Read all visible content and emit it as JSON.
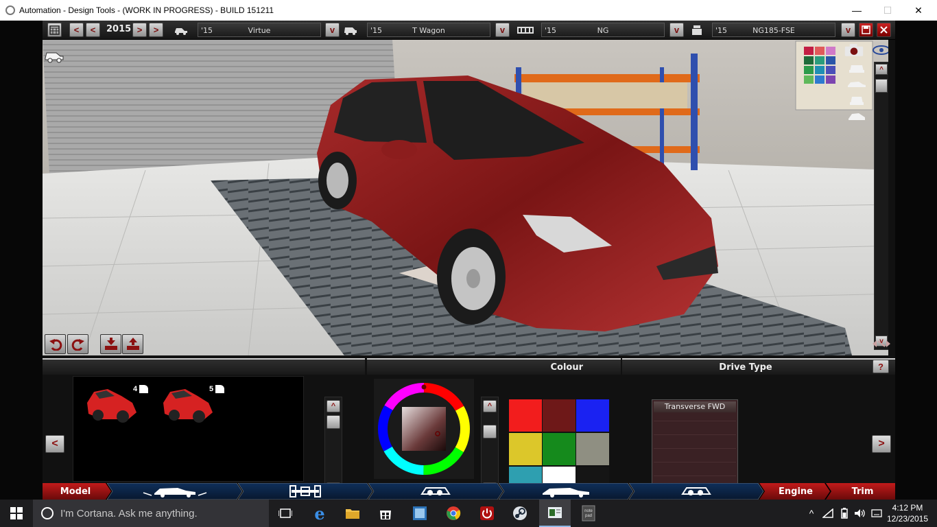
{
  "window": {
    "title": "Automation - Design Tools - (WORK IN PROGRESS) - BUILD 151211",
    "minimize": "—",
    "maximize": "☐",
    "close": "✕"
  },
  "toolbar": {
    "year": "2015",
    "selectors": [
      {
        "year": "'15",
        "name": "Virtue"
      },
      {
        "year": "'15",
        "name": "T  Wagon"
      },
      {
        "year": "'15",
        "name": "NG"
      },
      {
        "year": "'15",
        "name": "NG185-FSE"
      }
    ],
    "dropdown_glyph": "v",
    "prev_glyph": "<",
    "next_glyph": ">"
  },
  "lower": {
    "colour_header": "Colour",
    "drive_type_header": "Drive Type",
    "help_glyph": "?",
    "left_nav": "<",
    "right_nav": ">",
    "variants": [
      {
        "doors": "4"
      },
      {
        "doors": "5"
      }
    ],
    "drive_type_option": "Transverse FWD",
    "swatches": [
      "#f21d1d",
      "#6e1818",
      "#1a22f2",
      "#dcc72a",
      "#158a1c",
      "#8f8f82",
      "#2e9fb0",
      "#ffffff",
      "#151515"
    ]
  },
  "bottom_nav": {
    "model": "Model",
    "engine": "Engine",
    "trim": "Trim"
  },
  "taskbar": {
    "search_placeholder": "I'm Cortana. Ask me anything.",
    "time": "4:12 PM",
    "date": "12/23/2015"
  }
}
